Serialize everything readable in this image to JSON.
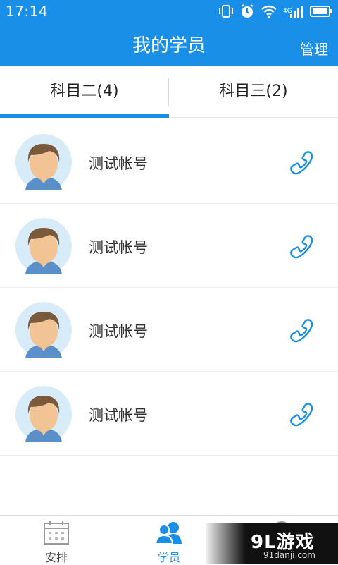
{
  "status_bar": {
    "time": "17:14",
    "network": "4G"
  },
  "header": {
    "title": "我的学员",
    "manage_label": "管理"
  },
  "tabs": [
    {
      "label": "科目二(4)",
      "active": true
    },
    {
      "label": "科目三(2)",
      "active": false
    }
  ],
  "students": [
    {
      "name": "测试帐号"
    },
    {
      "name": "测试帐号"
    },
    {
      "name": "测试帐号"
    },
    {
      "name": "测试帐号"
    }
  ],
  "bottom_nav": [
    {
      "label": "安排",
      "icon": "calendar-icon"
    },
    {
      "label": "学员",
      "icon": "students-icon",
      "active": true
    },
    {
      "label": "",
      "icon": "profile-icon"
    }
  ],
  "watermark": {
    "logo": "9L游戏",
    "url": "91danji.com"
  },
  "colors": {
    "primary": "#1a8fe8",
    "avatar_bg": "#d7ecf8",
    "hair": "#7a5a3c",
    "skin": "#f2c393"
  }
}
